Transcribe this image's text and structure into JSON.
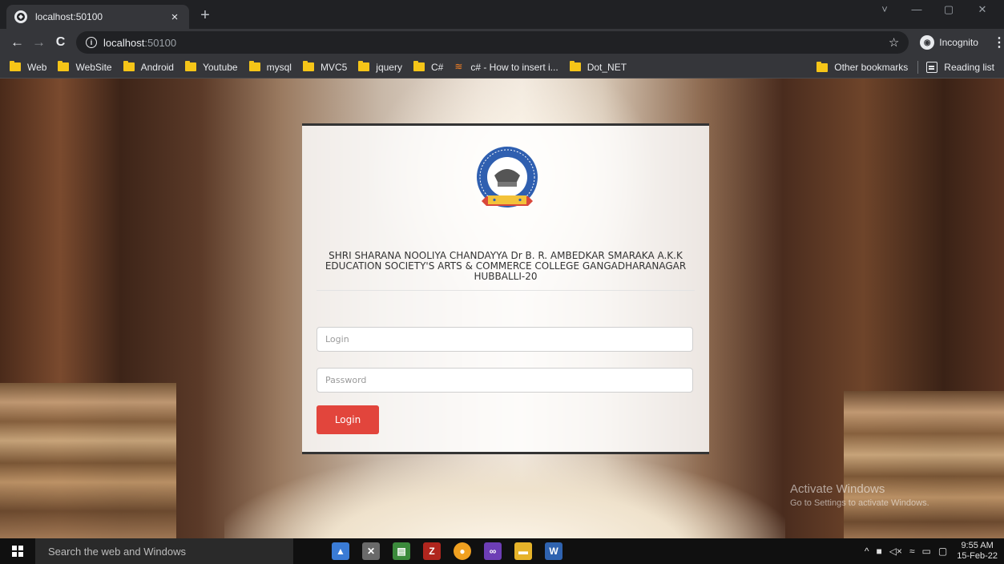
{
  "browser": {
    "tab": {
      "title": "localhost:50100",
      "close": "×"
    },
    "new_tab": "+",
    "window_controls": [
      "˅",
      "—",
      "▢",
      "✕"
    ],
    "address": {
      "host": "localhost",
      "port": ":50100"
    },
    "profile_label": "Incognito",
    "bookmarks": [
      {
        "label": "Web",
        "icon": "folder-icon"
      },
      {
        "label": "WebSite",
        "icon": "folder-icon"
      },
      {
        "label": "Android",
        "icon": "folder-icon"
      },
      {
        "label": "Youtube",
        "icon": "folder-icon"
      },
      {
        "label": "mysql",
        "icon": "folder-icon"
      },
      {
        "label": "MVC5",
        "icon": "folder-icon"
      },
      {
        "label": "jquery",
        "icon": "folder-icon"
      },
      {
        "label": "C#",
        "icon": "folder-icon"
      },
      {
        "label": "c# - How to insert i...",
        "icon": "stackoverflow-icon"
      },
      {
        "label": "Dot_NET",
        "icon": "folder-icon"
      }
    ],
    "other_bookmarks": "Other bookmarks",
    "reading_list": "Reading list"
  },
  "login": {
    "college_name": "SHRI SHARANA NOOLIYA CHANDAYYA Dr B. R. AMBEDKAR SMARAKA A.K.K EDUCATION SOCIETY'S ARTS & COMMERCE COLLEGE GANGADHARANAGAR HUBBALLI-20",
    "login_placeholder": "Login",
    "password_placeholder": "Password",
    "button_label": "Login"
  },
  "watermark": {
    "title": "Activate Windows",
    "subtitle": "Go to Settings to activate Windows."
  },
  "taskbar": {
    "search_placeholder": "Search the web and Windows",
    "time": "9:55 AM",
    "date": "15-Feb-22"
  },
  "colors": {
    "accent_button": "#e2453c",
    "card_border": "#333333",
    "chrome_dark": "#202124",
    "chrome_toolbar": "#35363a"
  }
}
